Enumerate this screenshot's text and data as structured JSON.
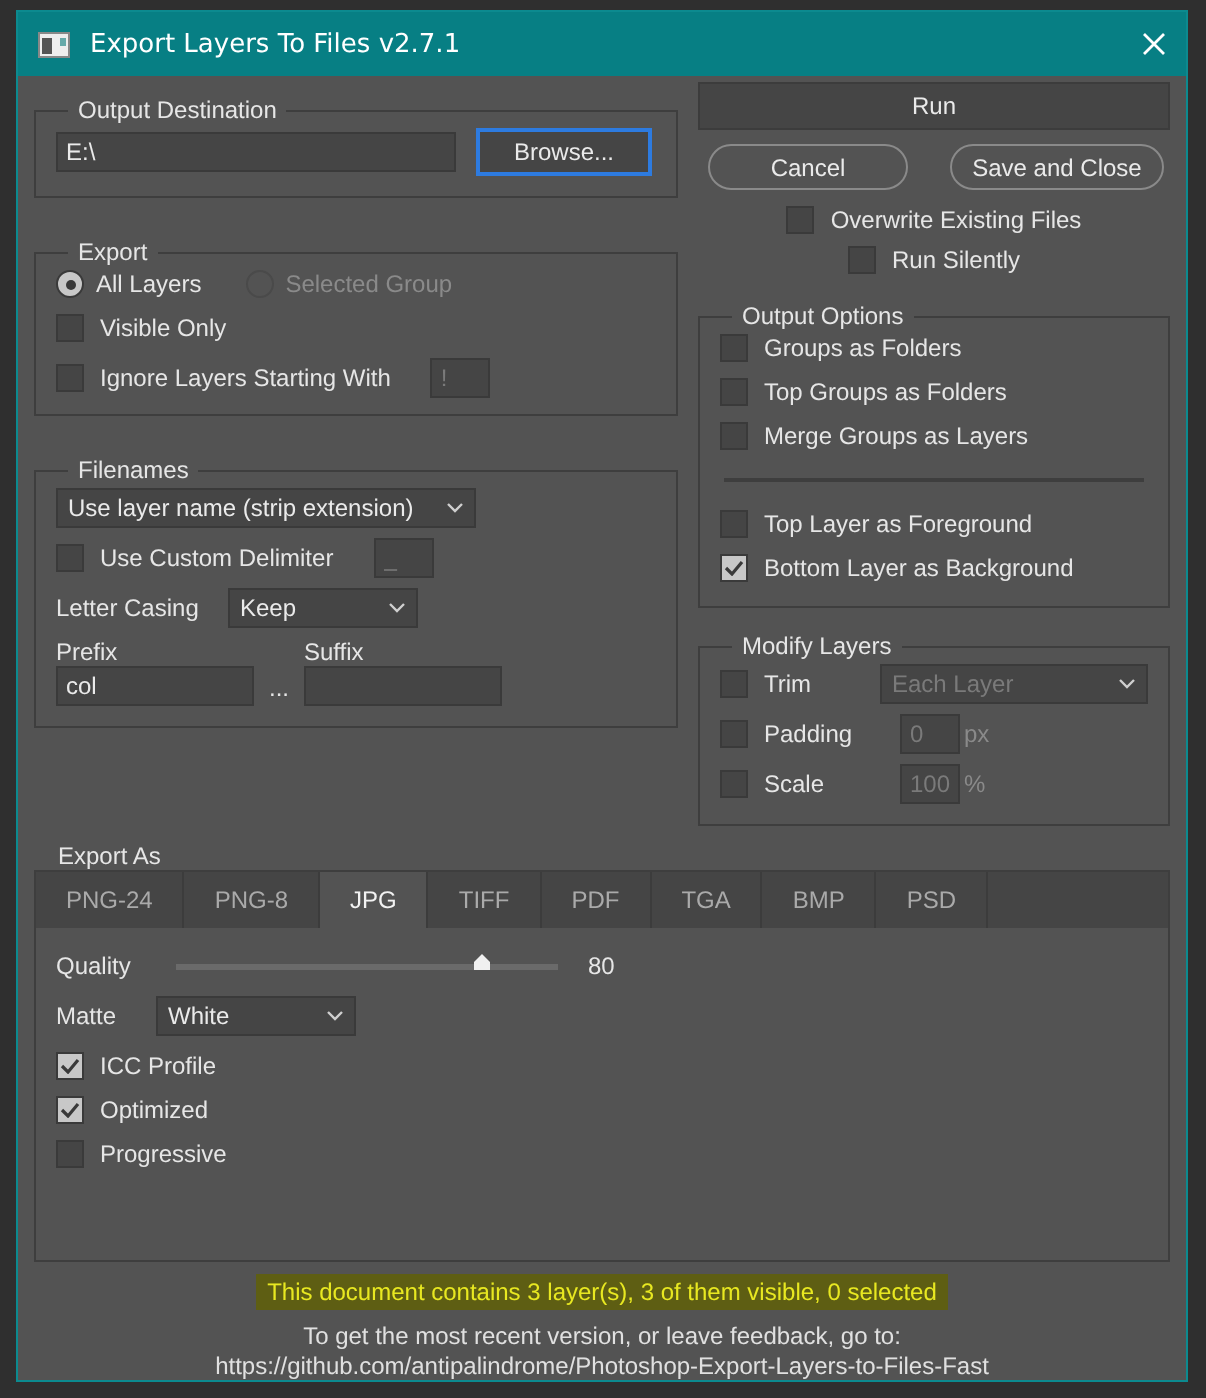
{
  "window": {
    "title": "Export Layers To Files v2.7.1"
  },
  "output_destination": {
    "title": "Output Destination",
    "path": "E:\\",
    "browse": "Browse...",
    "browse_focused": true
  },
  "actions": {
    "run": "Run",
    "cancel": "Cancel",
    "save_close": "Save and Close"
  },
  "run_options": [
    {
      "label": "Overwrite Existing Files",
      "checked": false
    },
    {
      "label": "Run Silently",
      "checked": false
    }
  ],
  "export": {
    "title": "Export",
    "scope": [
      {
        "label": "All Layers",
        "selected": true,
        "disabled": false
      },
      {
        "label": "Selected Group",
        "selected": false,
        "disabled": true
      }
    ],
    "visible_only": {
      "label": "Visible Only",
      "checked": false
    },
    "ignore": {
      "label": "Ignore Layers Starting With",
      "checked": false,
      "value": "!",
      "disabled": true
    }
  },
  "filenames": {
    "title": "Filenames",
    "naming": "Use layer name (strip extension)",
    "delimiter": {
      "label": "Use Custom Delimiter",
      "checked": false,
      "value": "_",
      "disabled": true
    },
    "casing_label": "Letter Casing",
    "casing": "Keep",
    "prefix_label": "Prefix",
    "prefix": "col",
    "separator": "...",
    "suffix_label": "Suffix"
  },
  "output_options": {
    "title": "Output Options",
    "sections": [
      {
        "items": [
          {
            "label": "Groups as Folders",
            "checked": false
          },
          {
            "label": "Top Groups as Folders",
            "checked": false
          },
          {
            "label": "Merge Groups as Layers",
            "checked": false
          }
        ]
      },
      {
        "items": [
          {
            "label": "Top Layer as Foreground",
            "checked": false
          },
          {
            "label": "Bottom Layer as Background",
            "checked": true
          }
        ]
      }
    ]
  },
  "modify_layers": {
    "title": "Modify Layers",
    "rows": [
      {
        "kind": "select",
        "label": "Trim",
        "checked": false,
        "value": "Each Layer",
        "disabled": true
      },
      {
        "kind": "number",
        "label": "Padding",
        "checked": false,
        "value": "0",
        "unit": "px",
        "disabled": true
      },
      {
        "kind": "number",
        "label": "Scale",
        "checked": false,
        "value": "100",
        "unit": "%",
        "disabled": true
      }
    ]
  },
  "export_as": {
    "title": "Export As",
    "tabs": [
      {
        "label": "PNG-24",
        "selected": false
      },
      {
        "label": "PNG-8",
        "selected": false
      },
      {
        "label": "JPG",
        "selected": true
      },
      {
        "label": "TIFF",
        "selected": false
      },
      {
        "label": "PDF",
        "selected": false
      },
      {
        "label": "TGA",
        "selected": false
      },
      {
        "label": "BMP",
        "selected": false
      },
      {
        "label": "PSD",
        "selected": false
      }
    ],
    "quality": {
      "label": "Quality",
      "level": 0.8,
      "reading": "80"
    },
    "matte": {
      "label": "Matte",
      "value": "White"
    },
    "options": [
      {
        "label": "ICC Profile",
        "checked": true
      },
      {
        "label": "Optimized",
        "checked": true
      },
      {
        "label": "Progressive",
        "checked": false
      }
    ]
  },
  "status": "This document contains 3 layer(s), 3 of them visible, 0 selected",
  "footer": [
    "To get the most recent version, or leave feedback, go to:",
    "https://github.com/antipalindrome/Photoshop-Export-Layers-to-Files-Fast"
  ]
}
